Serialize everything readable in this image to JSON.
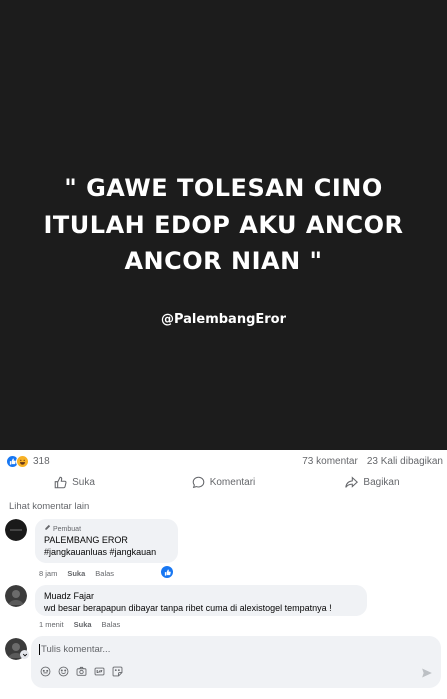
{
  "post": {
    "quote_lines": [
      "\" GAWE TOLESAN CINO",
      "ITULAH EDOP AKU ANCOR",
      "ANCOR NIAN \""
    ],
    "handle": "@PalembangEror"
  },
  "stats": {
    "reaction_count": "318",
    "comments": "73 komentar",
    "shares": "23 Kali dibagikan"
  },
  "actions": {
    "like": "Suka",
    "comment": "Komentari",
    "share": "Bagikan"
  },
  "more_comments": "Lihat komentar lain",
  "comments": [
    {
      "badge": "Pembuat",
      "author": "PALEMBANG EROR",
      "text": "#jangkauanluas #jangkauan",
      "time": "8 jam",
      "like": "Suka",
      "reply": "Balas"
    },
    {
      "author": "Muadz Fajar",
      "text": "wd besar berapapun dibayar tanpa ribet cuma di alexistogel tempatnya !",
      "time": "1 menit",
      "like": "Suka",
      "reply": "Balas"
    }
  ],
  "composer": {
    "placeholder": "Tulis komentar..."
  },
  "colors": {
    "post_background": "#1c1c1c",
    "accent": "#1877f2",
    "secondary_text": "#65676b",
    "bubble": "#f0f2f5"
  }
}
